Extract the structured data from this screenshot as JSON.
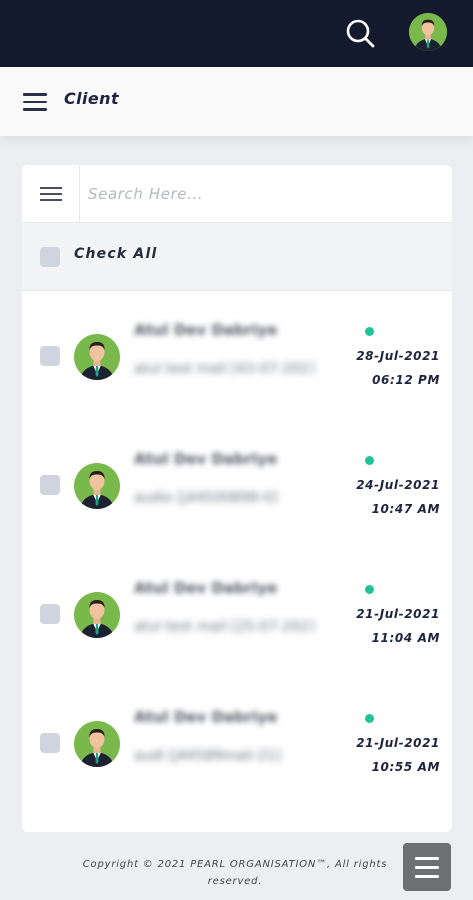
{
  "topbar": {
    "search_icon": "search-icon",
    "avatar": "user-avatar"
  },
  "header": {
    "menu_icon": "hamburger-menu-icon",
    "title": "Client"
  },
  "search": {
    "placeholder": "Search Here..."
  },
  "check_all": {
    "label": "Check All"
  },
  "items": [
    {
      "name": "Atul Dev Dabriye",
      "message": "atul test mail [43-07-2021]",
      "date": "28-Jul-2021",
      "time": "06:12 PM",
      "status": "online"
    },
    {
      "name": "Atul Dev Dabriye",
      "message": "audio [j44500898-0]",
      "date": "24-Jul-2021",
      "time": "10:47 AM",
      "status": "online"
    },
    {
      "name": "Atul Dev Dabriye",
      "message": "atul test mail [25-07-2021]",
      "date": "21-Jul-2021",
      "time": "11:04 AM",
      "status": "online"
    },
    {
      "name": "Atul Dev Dabriye",
      "message": "audi [j44589mail-21]",
      "date": "21-Jul-2021",
      "time": "10:55 AM",
      "status": "online"
    }
  ],
  "footer": {
    "line1": "Copyright © 2021 PEARL ORGANISATION™, All rights",
    "line2": "reserved."
  },
  "colors": {
    "topbar": "#141a2e",
    "accent_status": "#20c29a",
    "avatar_bg": "#79b84a"
  }
}
